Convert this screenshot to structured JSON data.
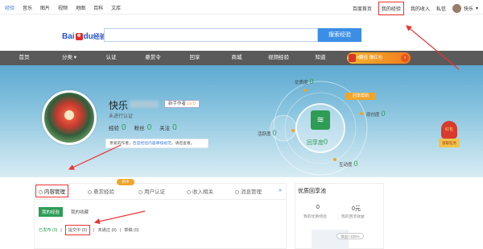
{
  "topbar": {
    "links": [
      "经验",
      "音乐",
      "图片",
      "视频",
      "地图",
      "百科",
      "文库"
    ],
    "home": "百度首页",
    "my_experience": "我的经验",
    "my_income": "我的收入",
    "messages": "私信",
    "username": "快乐"
  },
  "search": {
    "logo_bai": "Bai",
    "logo_du": "du",
    "logo_jy": "经验",
    "button": "搜索经验"
  },
  "nav": {
    "items": [
      "首页",
      "分类",
      "认证",
      "悬赏令",
      "回享",
      "商城",
      "视频经验",
      "知道"
    ],
    "promo": "#翻倍 赚红包"
  },
  "profile": {
    "name": "快乐",
    "level_prefix": "新手作者",
    "level": "LV.0",
    "verify": "未进行认证",
    "stats": [
      {
        "label": "经验",
        "value": "0"
      },
      {
        "label": "粉丝",
        "value": "0"
      },
      {
        "label": "关注",
        "value": "0"
      }
    ],
    "notice_a": "亲爱的作者，",
    "notice_link": "百度经验内容审核规范",
    "notice_b": "，请您查看。"
  },
  "radar": {
    "metrics": [
      {
        "label": "优质度",
        "value": "0"
      },
      {
        "label": "原创度",
        "value": "0"
      },
      {
        "label": "活跃度",
        "value": "0"
      },
      {
        "label": "互动度",
        "value": "0"
      }
    ],
    "center_label": "回享度",
    "center_value": "0",
    "tag": "回享帮助"
  },
  "lantern": {
    "top": "红包",
    "bottom": "领取任务"
  },
  "tabs": {
    "items": [
      "内容管理",
      "悬赏经验",
      "用户认证",
      "收入相关",
      "消息管理"
    ],
    "badge": "新手",
    "more": "»",
    "subtabs": [
      "我的经验",
      "我的收藏"
    ],
    "filters": {
      "published": "已发布 (0)",
      "pending": "提交中 (0)",
      "rejected": "未通过 (0)",
      "draft": "草稿 (0)"
    }
  },
  "side": {
    "title": "优质回享池",
    "count1": "0",
    "label1": "我的优质经验",
    "count2": "0元",
    "label2": "我的回享收益",
    "pill": "收益+100%"
  },
  "colors": {
    "accent": "#3b8ee6",
    "green": "#2e9c55",
    "nav_bg": "#5a5a5a",
    "orange": "#f0a52b",
    "annotation_red": "#e33"
  }
}
